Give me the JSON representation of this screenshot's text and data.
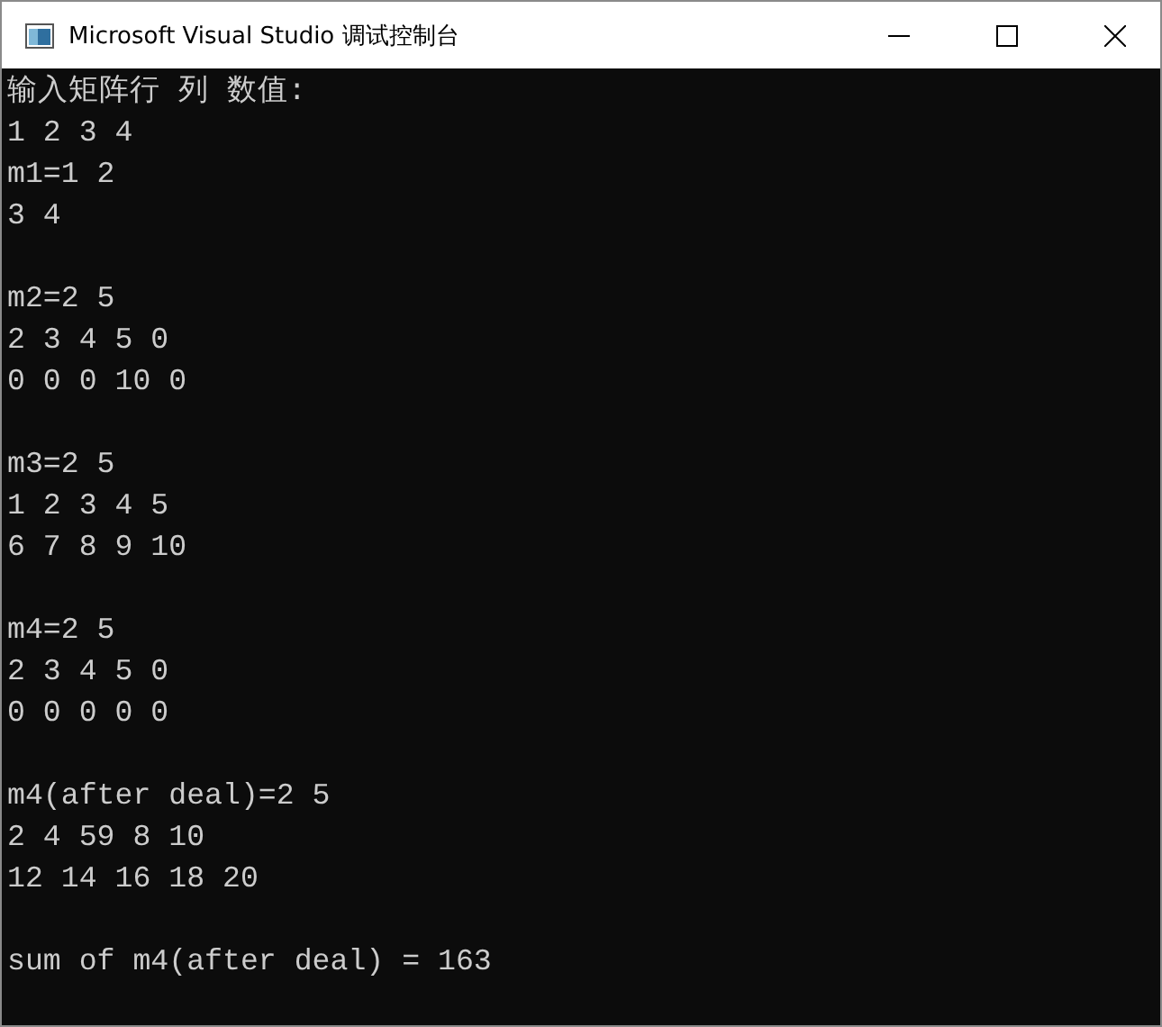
{
  "window": {
    "title": "Microsoft Visual Studio 调试控制台"
  },
  "console": {
    "blocks": [
      [
        "输入矩阵行 列 数值:",
        "1 2 3 4",
        "m1=1 2",
        "3 4"
      ],
      [
        "m2=2 5",
        "2 3 4 5 0",
        "0 0 0 10 0"
      ],
      [
        "m3=2 5",
        "1 2 3 4 5",
        "6 7 8 9 10"
      ],
      [
        "m4=2 5",
        "2 3 4 5 0",
        "0 0 0 0 0"
      ],
      [
        "m4(after deal)=2 5",
        "2 4 59 8 10",
        "12 14 16 18 20"
      ],
      [
        "sum of m4(after deal) = 163"
      ]
    ]
  }
}
